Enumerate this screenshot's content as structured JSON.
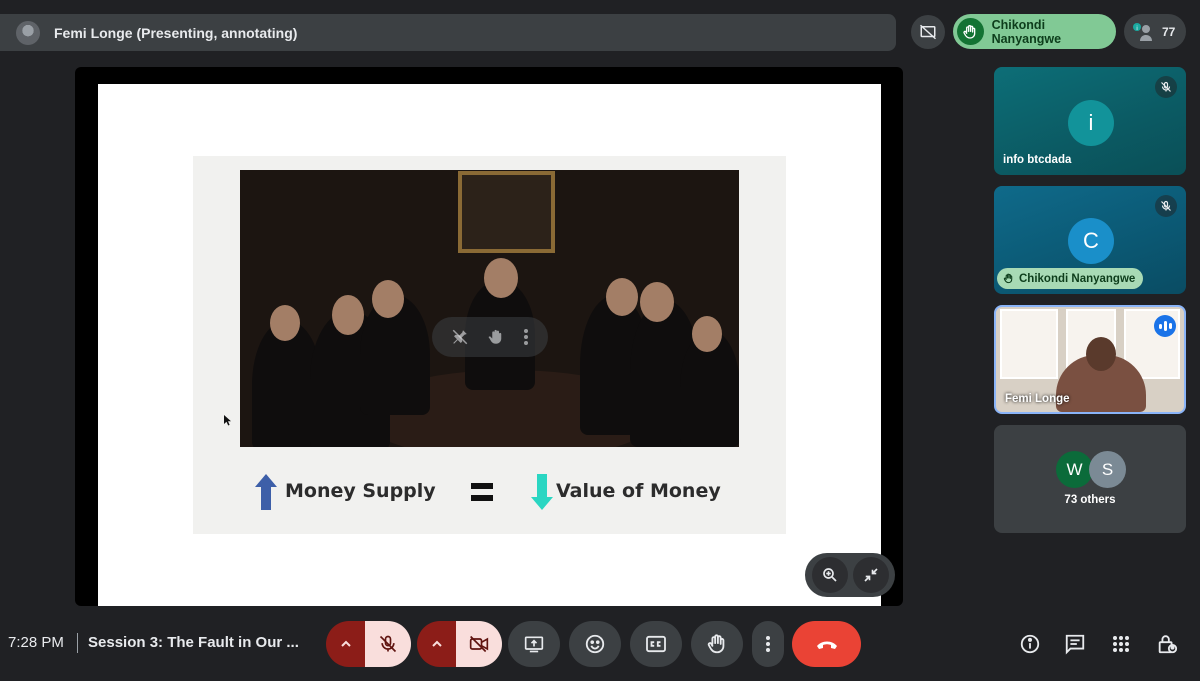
{
  "presenter": {
    "name": "Femi Longe (Presenting, annotating)"
  },
  "top_right": {
    "raised_hand_name": "Chikondi Nanyangwe",
    "participant_count": "77"
  },
  "slide": {
    "left_label": "Money Supply",
    "right_label": "Value of Money",
    "up_arrow_color": "#3d5fa8",
    "down_arrow_color": "#2ad6c2"
  },
  "tiles": [
    {
      "initial": "i",
      "name": "info btcdada",
      "avatar_color": "#12939a"
    },
    {
      "initial": "C",
      "name": "Chikondi Nanyangwe",
      "avatar_color": "#1a8fc9"
    },
    {
      "name": "Femi Longe"
    },
    {
      "avatars": [
        "W",
        "S"
      ],
      "label": "73 others"
    }
  ],
  "bottom": {
    "time": "7:28 PM",
    "meeting_title": "Session 3: The Fault in Our ..."
  }
}
